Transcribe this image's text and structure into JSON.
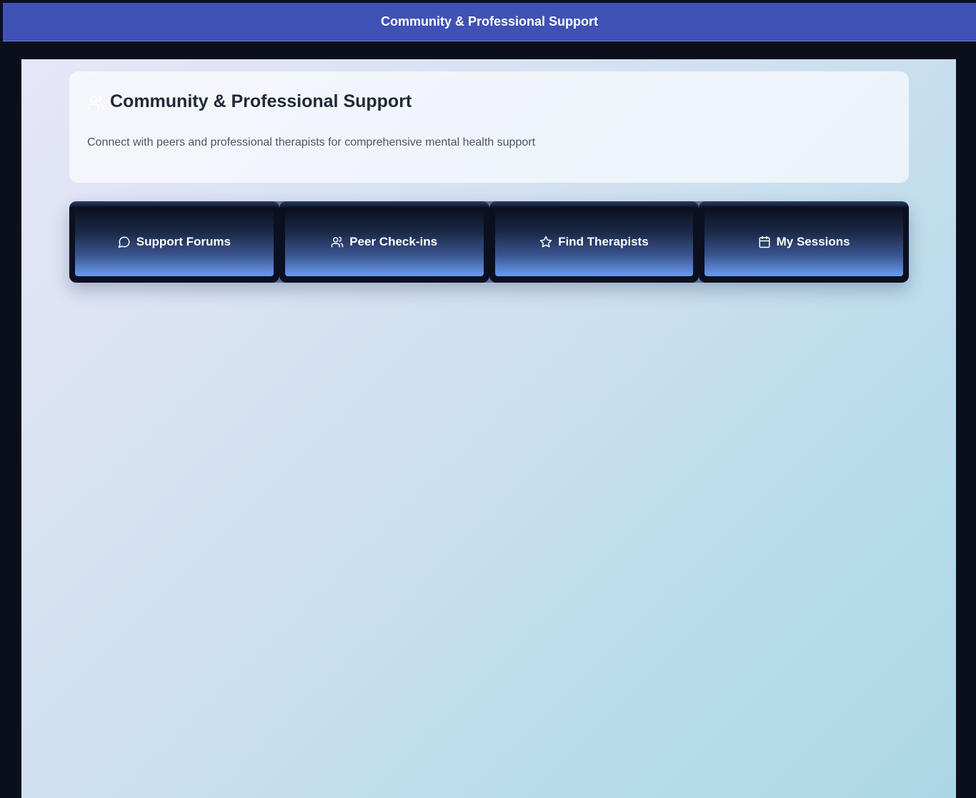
{
  "window": {
    "title": "Community & Professional Support"
  },
  "header": {
    "title": "Community & Professional Support",
    "subtitle": "Connect with peers and professional therapists for comprehensive mental health support",
    "icon": "users-icon"
  },
  "tabs": [
    {
      "label": "Support Forums",
      "icon": "message-circle-icon"
    },
    {
      "label": "Peer Check-ins",
      "icon": "users-icon"
    },
    {
      "label": "Find Therapists",
      "icon": "star-icon"
    },
    {
      "label": "My Sessions",
      "icon": "calendar-icon"
    }
  ],
  "colors": {
    "titlebar": "#3f51b5",
    "frame": "#0b0f1c",
    "tab_gradient_bottom": "#6a9cf0",
    "heading_text": "#1f2937",
    "subtitle_text": "#4b5563"
  }
}
